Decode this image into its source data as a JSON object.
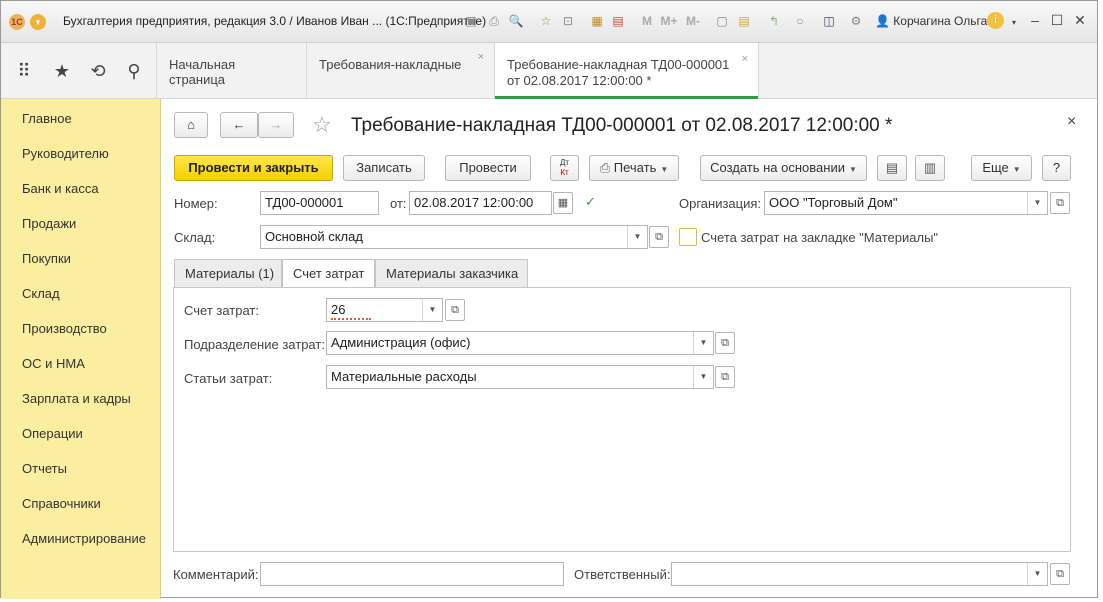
{
  "titlebar": {
    "title": "Бухгалтерия предприятия, редакция 3.0 / Иванов Иван ...  (1С:Предприятие)",
    "user": "Корчагина Ольга",
    "m_label": "M",
    "mplus_label": "M+",
    "mminus_label": "M-"
  },
  "tabs": [
    {
      "label": "Начальная страница"
    },
    {
      "label": "Требования-накладные",
      "close": "×"
    },
    {
      "label1": "Требование-накладная ТД00-000001",
      "label2": "от 02.08.2017 12:00:00 *",
      "close": "×"
    }
  ],
  "sidebar": {
    "items": [
      "Главное",
      "Руководителю",
      "Банк и касса",
      "Продажи",
      "Покупки",
      "Склад",
      "Производство",
      "ОС и НМА",
      "Зарплата и кадры",
      "Операции",
      "Отчеты",
      "Справочники",
      "Администрирование"
    ]
  },
  "document": {
    "title": "Требование-накладная ТД00-000001 от 02.08.2017 12:00:00 *",
    "close": "×"
  },
  "toolbar": {
    "post_close": "Провести и закрыть",
    "save": "Записать",
    "post": "Провести",
    "dtkt_top": "Дт",
    "dtkt_bottom": "Кт",
    "print": "Печать",
    "create_based": "Создать на основании",
    "more": "Еще",
    "help": "?"
  },
  "fields": {
    "number_label": "Номер:",
    "number_value": "ТД00-000001",
    "date_label": "от:",
    "date_value": "02.08.2017 12:00:00",
    "org_label": "Организация:",
    "org_value": "ООО \"Торговый Дом\"",
    "warehouse_label": "Склад:",
    "warehouse_value": "Основной склад",
    "checkbox_label": "Счета затрат на закладке \"Материалы\""
  },
  "page_tabs": [
    "Материалы (1)",
    "Счет затрат",
    "Материалы заказчика"
  ],
  "cost_panel": {
    "account_label": "Счет затрат:",
    "account_value": "26",
    "division_label": "Подразделение затрат:",
    "division_value": "Администрация (офис)",
    "items_label": "Статьи затрат:",
    "items_value": "Материальные расходы"
  },
  "footer": {
    "comment_label": "Комментарий:",
    "comment_value": "",
    "responsible_label": "Ответственный:",
    "responsible_value": ""
  }
}
